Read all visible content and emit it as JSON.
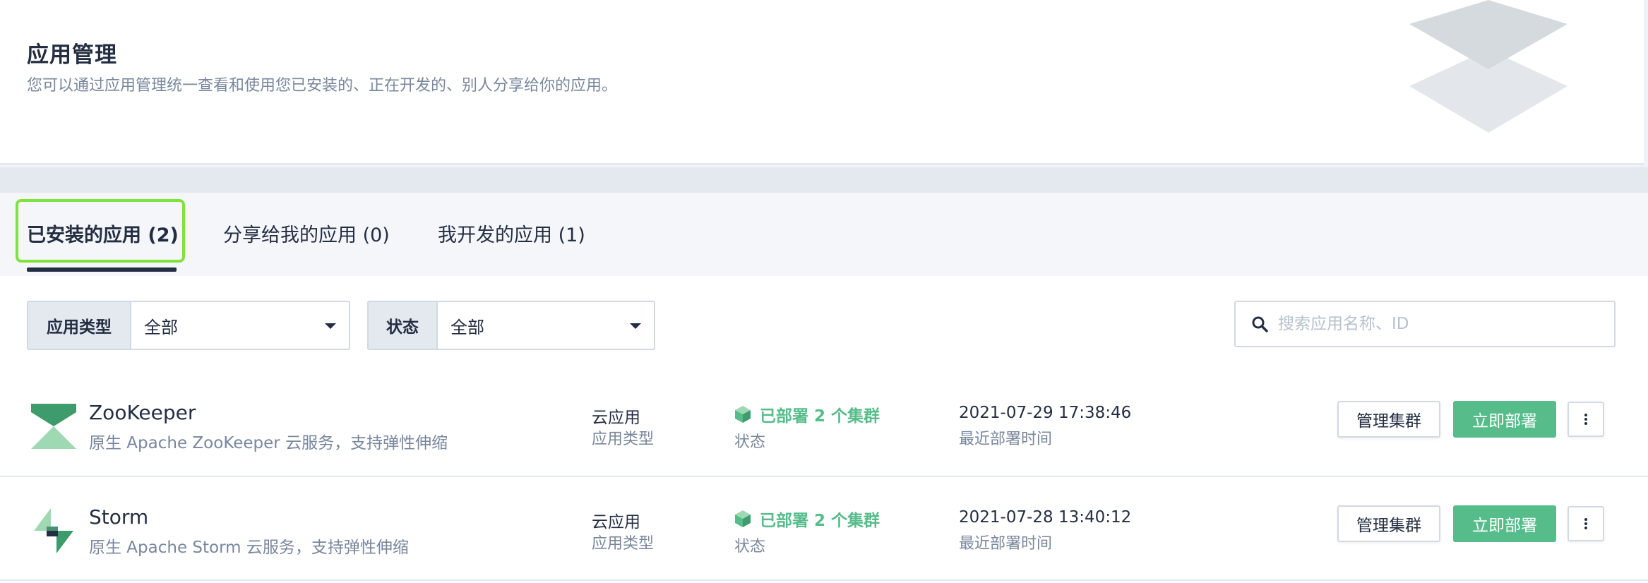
{
  "header": {
    "title": "应用管理",
    "description": "您可以通过应用管理统一查看和使用您已安装的、正在开发的、别人分享给你的应用。"
  },
  "tabs": [
    {
      "label": "已安装的应用 (2)",
      "active": true
    },
    {
      "label": "分享给我的应用 (0)",
      "active": false
    },
    {
      "label": "我开发的应用 (1)",
      "active": false
    }
  ],
  "filters": {
    "app_type": {
      "label": "应用类型",
      "value": "全部"
    },
    "status": {
      "label": "状态",
      "value": "全部"
    }
  },
  "search": {
    "placeholder": "搜索应用名称、ID",
    "icon": "search-icon"
  },
  "apps": [
    {
      "name": "ZooKeeper",
      "description": "原生 Apache ZooKeeper 云服务，支持弹性伸缩",
      "type_value": "云应用",
      "type_label": "应用类型",
      "status_value": "已部署 2 个集群",
      "status_label": "状态",
      "time_value": "2021-07-29 17:38:46",
      "time_label": "最近部署时间",
      "manage_label": "管理集群",
      "deploy_label": "立即部署",
      "icon": "zookeeper-logo-icon"
    },
    {
      "name": "Storm",
      "description": "原生 Apache Storm 云服务，支持弹性伸缩",
      "type_value": "云应用",
      "type_label": "应用类型",
      "status_value": "已部署 2 个集群",
      "status_label": "状态",
      "time_value": "2021-07-28 13:40:12",
      "time_label": "最近部署时间",
      "manage_label": "管理集群",
      "deploy_label": "立即部署",
      "icon": "storm-logo-icon"
    }
  ],
  "colors": {
    "accent": "#55bc8a",
    "text_primary": "#242e42",
    "text_secondary": "#79879c",
    "tab_highlight": "#7fe33b"
  }
}
